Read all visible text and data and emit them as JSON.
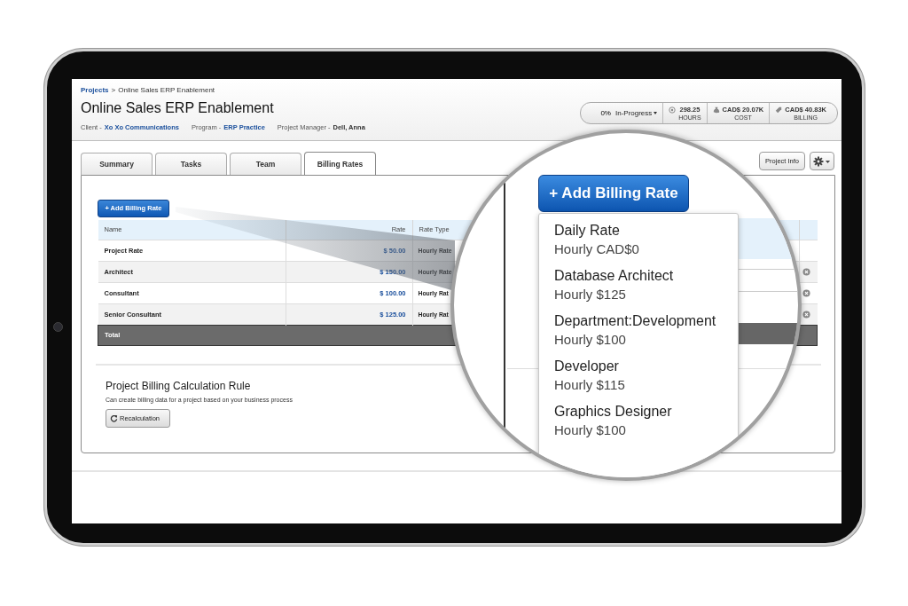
{
  "breadcrumb": {
    "link": "Projects",
    "separator": ">",
    "current": "Online Sales ERP Enablement"
  },
  "title": "Online Sales ERP Enablement",
  "meta": [
    {
      "label": "Client -",
      "value": "Xo Xo Communications",
      "kind": "link"
    },
    {
      "label": "Program -",
      "value": "ERP Practice",
      "kind": "link"
    },
    {
      "label": "Project Manager -",
      "value": "Dell, Anna",
      "kind": "bold"
    }
  ],
  "status": {
    "progress": "0%",
    "state": "In-Progress"
  },
  "stats": [
    {
      "kind": "hours",
      "value": "298.25",
      "label": "HOURS"
    },
    {
      "kind": "cost",
      "value": "CAD$ 20.07K",
      "label": "COST"
    },
    {
      "kind": "billing",
      "value": "CAD$ 40.83K",
      "label": "BILLING"
    }
  ],
  "tabs": [
    {
      "label": "Summary",
      "selected": false
    },
    {
      "label": "Tasks",
      "selected": false
    },
    {
      "label": "Team",
      "selected": false
    },
    {
      "label": "Billing Rates",
      "selected": true
    }
  ],
  "project_info_button": "Project Info",
  "add_button": "+ Add Billing Rate",
  "table": {
    "columns": [
      "Name",
      "Rate",
      "Rate Type"
    ],
    "rows": [
      {
        "name": "Project Rate",
        "rate": "$ 50.00",
        "rate_type": "Hourly Rate",
        "deletable": false
      },
      {
        "name": "Architect",
        "rate": "$ 150.00",
        "rate_type": "Hourly Rate",
        "deletable": true
      },
      {
        "name": "Consultant",
        "rate": "$ 100.00",
        "rate_type": "Hourly Rat",
        "deletable": true
      },
      {
        "name": "Senior Consultant",
        "rate": "$ 125.00",
        "rate_type": "Hourly Rat",
        "deletable": true
      }
    ],
    "total": "Total"
  },
  "rule": {
    "title": "Project Billing Calculation Rule",
    "description": "Can create billing data for a project based on your business process",
    "button": "Recalculation"
  },
  "magnifier": {
    "button": "+ Add Billing Rate",
    "menu": [
      {
        "name": "Daily Rate",
        "rate": "Hourly CAD$0"
      },
      {
        "name": "Database Architect",
        "rate": "Hourly $125"
      },
      {
        "name": "Department:Development",
        "rate": "Hourly $100"
      },
      {
        "name": "Developer",
        "rate": "Hourly $115"
      },
      {
        "name": "Graphics Designer",
        "rate": "Hourly $100"
      }
    ]
  }
}
